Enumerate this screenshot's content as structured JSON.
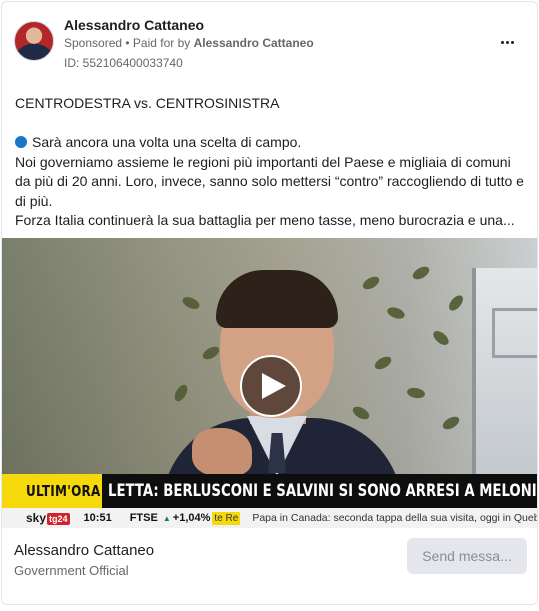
{
  "header": {
    "page_name": "Alessandro Cattaneo",
    "sponsored_label": "Sponsored",
    "paid_for_prefix": " • Paid for by ",
    "paid_for_by": "Alessandro Cattaneo",
    "ad_id": "ID: 552106400033740"
  },
  "ad_text": {
    "line1": "CENTRODESTRA vs. CENTROSINISTRA",
    "line2": "Sarà ancora una volta una scelta di campo.",
    "line3": "Noi governiamo assieme le regioni più importanti del Paese e migliaia di comuni da più di 20 anni. Loro, invece, sanno solo mettersi “contro” raccogliendo di tutto e di più.",
    "line4": "Forza Italia continuerà la sua battaglia per meno tasse, meno burocrazia e una..."
  },
  "video": {
    "banner_label": "ULTIM'ORA",
    "headline": "LETTA: BERLUSCONI E SALVINI SI SONO ARRESI A MELONI AJALASIA",
    "channel_logo": "sky",
    "channel_badge": "tg24",
    "clock": "10:51",
    "ticker_index": "FTSE",
    "ticker_arrow": "▲",
    "ticker_value": "+1,04%",
    "ticker_tail": "te Re",
    "news_ticker": "Papa in Canada: seconda tappa della sua visita, oggi in Quebec. Mo"
  },
  "footer": {
    "name": "Alessandro Cattaneo",
    "category": "Government Official",
    "send_button": "Send messa..."
  },
  "colors": {
    "link_blue": "#1877c7",
    "ticker_yellow": "#f5d90a",
    "muted_text": "#65676b"
  },
  "icons": {
    "more": "more-options-icon",
    "play": "play-icon",
    "bullet": "blue-circle-icon"
  }
}
